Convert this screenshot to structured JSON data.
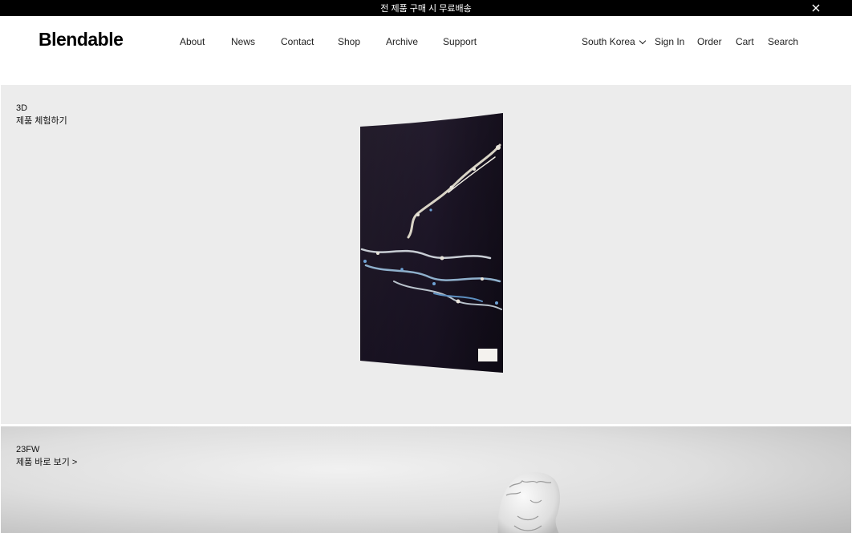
{
  "announcement": {
    "text": "전 제품 구매 시 무료배송",
    "close_icon": "close-icon"
  },
  "header": {
    "logo": "Blendable",
    "nav": [
      "About",
      "News",
      "Contact",
      "Shop",
      "Archive",
      "Support"
    ],
    "region": "South Korea",
    "links": [
      "Sign In",
      "Order",
      "Cart",
      "Search"
    ]
  },
  "sections": [
    {
      "tag": "3D",
      "link": "제품 체험하기"
    },
    {
      "tag": "23FW",
      "link": "제품 바로 보기 >"
    }
  ],
  "colors": {
    "announcement_bg": "#000000",
    "panel_bg": "#ececec",
    "fabric": "#1e1628"
  }
}
